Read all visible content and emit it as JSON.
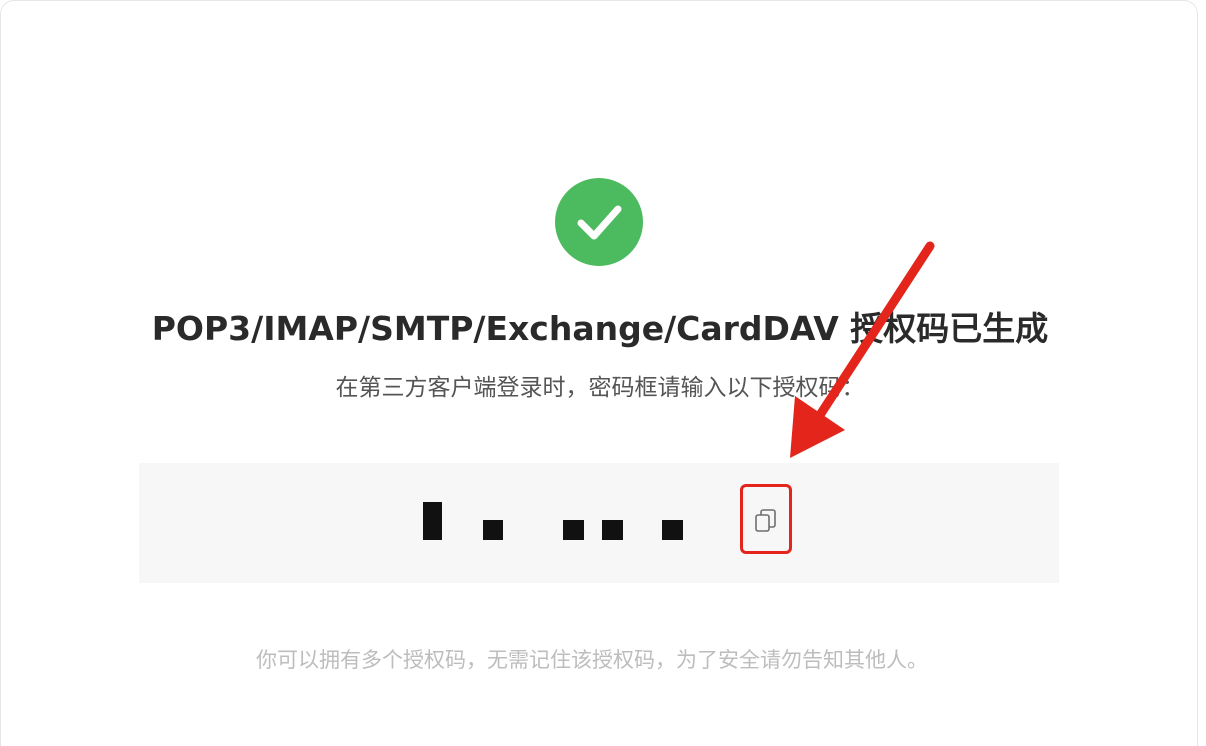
{
  "dialog": {
    "status_icon": "check-circle-icon",
    "title": "POP3/IMAP/SMTP/Exchange/CardDAV 授权码已生成",
    "subtitle": "在第三方客户端登录时，密码框请输入以下授权码：",
    "hint": "你可以拥有多个授权码，无需记住该授权码，为了安全请勿告知其他人。"
  },
  "code_box": {
    "code_redacted": true,
    "copy_icon": "copy-icon"
  },
  "annotation": {
    "arrow_icon": "red-arrow-icon",
    "highlight_color": "#e3251b"
  },
  "colors": {
    "success": "#4cbb5f",
    "title": "#2a2a2a",
    "subtitle": "#555555",
    "hint": "#bdbdbd",
    "code_background": "#f7f7f7"
  }
}
